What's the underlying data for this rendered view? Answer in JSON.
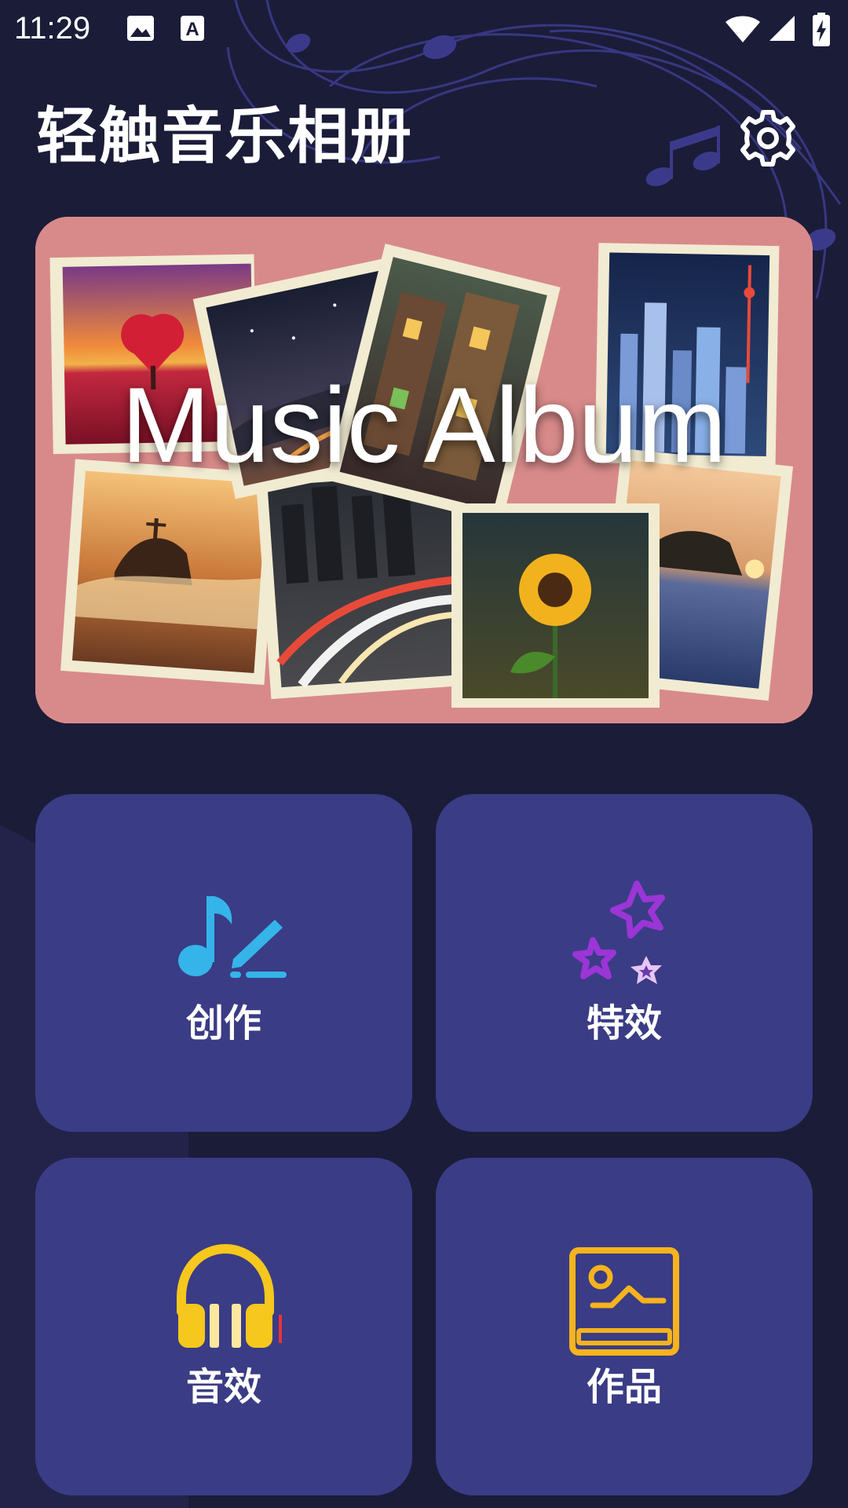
{
  "status_bar": {
    "time": "11:29",
    "icons": [
      "image-icon",
      "text-a-icon",
      "wifi-icon",
      "signal-icon",
      "battery-charging-icon"
    ]
  },
  "header": {
    "title": "轻触音乐相册",
    "settings_icon": "gear-icon"
  },
  "banner": {
    "text": "Music Album",
    "background_color": "#d88a8a"
  },
  "tiles": [
    {
      "label": "创作",
      "icon": "music-note-pen-icon",
      "color": "#35b4ea"
    },
    {
      "label": "特效",
      "icon": "stars-icon",
      "color": "#9b35d6"
    },
    {
      "label": "音效",
      "icon": "headphones-icon",
      "color": "#f6c71d"
    },
    {
      "label": "作品",
      "icon": "photo-frame-icon",
      "color": "#f6b31d"
    }
  ],
  "colors": {
    "background": "#1b1c38",
    "tile_background": "#3a3c85"
  }
}
